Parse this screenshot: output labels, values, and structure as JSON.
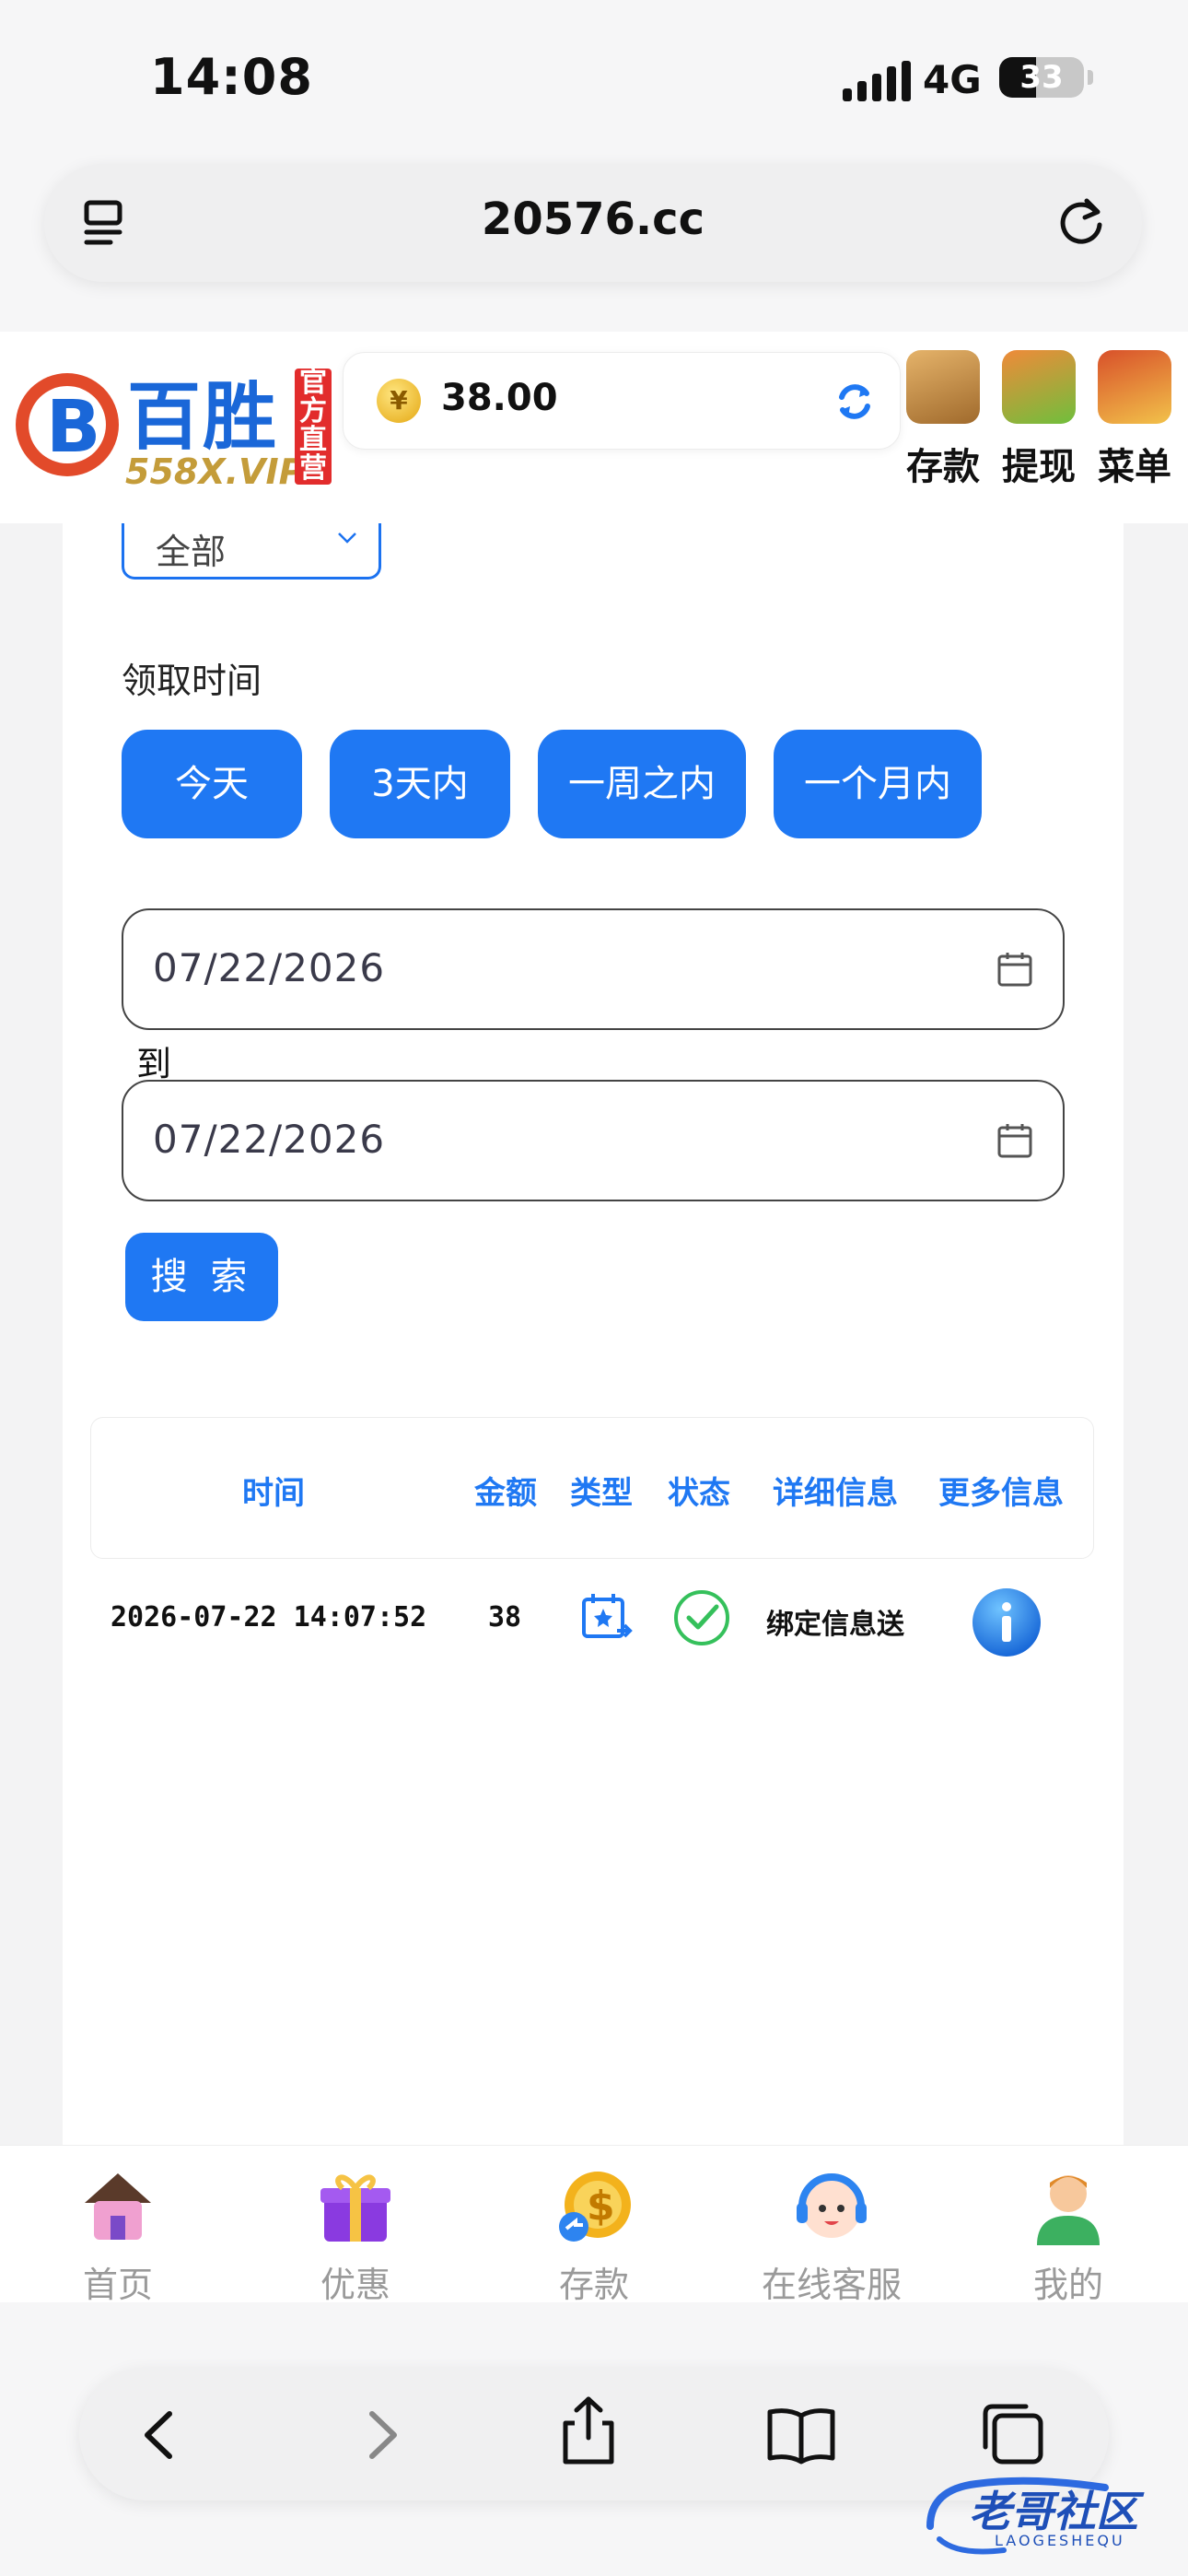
{
  "status_bar": {
    "time": "14:08",
    "network": "4G",
    "battery": "33"
  },
  "browser": {
    "domain": "20576.cc"
  },
  "header": {
    "logo_name": "百胜",
    "logo_sub": "558X.VIP",
    "logo_badge": "官方直营",
    "balance": "38.00",
    "actions": [
      {
        "label": "存款",
        "icon": "wallet-icon"
      },
      {
        "label": "提现",
        "icon": "withdraw-icon"
      },
      {
        "label": "菜单",
        "icon": "treasure-chest-icon"
      }
    ]
  },
  "filter": {
    "type_value": "全部",
    "time_label": "领取时间",
    "quick_ranges": [
      "今天",
      "3天内",
      "一周之内",
      "一个月内"
    ],
    "date_from": "07/22/2026",
    "to_label": "到",
    "date_to": "07/22/2026",
    "search_label": "搜 索"
  },
  "table": {
    "columns": [
      "时间",
      "金额",
      "类型",
      "状态",
      "详细信息",
      "更多信息"
    ],
    "rows": [
      {
        "time": "2026-07-22 14:07:52",
        "amount": "38",
        "type_icon": "gift-calendar-icon",
        "status_icon": "check-circle-icon",
        "detail": "绑定信息送",
        "more_icon": "info-icon"
      }
    ]
  },
  "bottom_nav": [
    {
      "label": "首页",
      "icon": "house-icon"
    },
    {
      "label": "优惠",
      "icon": "gift-box-icon"
    },
    {
      "label": "存款",
      "icon": "coin-icon"
    },
    {
      "label": "在线客服",
      "icon": "support-agent-icon"
    },
    {
      "label": "我的",
      "icon": "user-icon"
    }
  ],
  "watermark": {
    "text": "老哥社区",
    "sub": "LAOGESHEQU"
  },
  "colors": {
    "accent": "#1f78f3",
    "brand_blue": "#1a67d8",
    "badge_red": "#e22c2c",
    "success": "#35c05b"
  }
}
